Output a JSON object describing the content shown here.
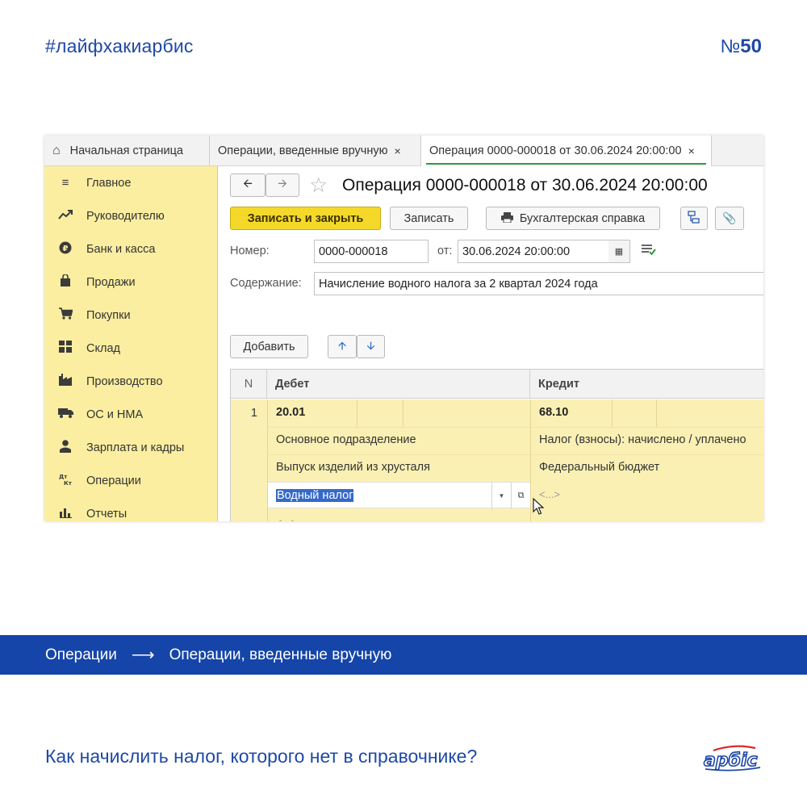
{
  "header": {
    "hashtag": "#лайфхакиарбис",
    "number_prefix": "№",
    "number": "50"
  },
  "tabs": [
    {
      "label": "Начальная страница",
      "icon": "home-icon"
    },
    {
      "label": "Операции, введенные вручную",
      "close": "×"
    },
    {
      "label": "Операция 0000-000018 от 30.06.2024 20:00:00",
      "close": "×",
      "active": true
    }
  ],
  "sidebar": {
    "items": [
      {
        "label": "Главное",
        "icon": "menu-icon"
      },
      {
        "label": "Руководителю",
        "icon": "trend-icon"
      },
      {
        "label": "Банк и касса",
        "icon": "ruble-icon"
      },
      {
        "label": "Продажи",
        "icon": "bag-icon"
      },
      {
        "label": "Покупки",
        "icon": "cart-icon"
      },
      {
        "label": "Склад",
        "icon": "warehouse-icon"
      },
      {
        "label": "Производство",
        "icon": "factory-icon"
      },
      {
        "label": "ОС и НМА",
        "icon": "truck-icon"
      },
      {
        "label": "Зарплата и кадры",
        "icon": "person-icon"
      },
      {
        "label": "Операции",
        "icon": "dt-kt-icon"
      },
      {
        "label": "Отчеты",
        "icon": "bar-chart-icon"
      }
    ],
    "dt_kt_glyph_top": "Дт",
    "dt_kt_glyph_bottom": "Кт"
  },
  "document": {
    "title": "Операция 0000-000018 от 30.06.2024 20:00:00",
    "buttons": {
      "save_close": "Записать и закрыть",
      "save": "Записать",
      "reference": "Бухгалтерская справка",
      "add": "Добавить"
    },
    "fields": {
      "number_label": "Номер:",
      "number_value": "0000-000018",
      "date_label": "от:",
      "date_value": "30.06.2024 20:00:00",
      "content_label": "Содержание:",
      "content_value": "Начисление водного налога за 2 квартал 2024 года"
    }
  },
  "grid": {
    "columns": {
      "n": "N",
      "debit": "Дебет",
      "credit": "Кредит"
    },
    "row": {
      "n": "1",
      "debit_account": "20.01",
      "credit_account": "68.10",
      "debit_subconto_1": "Основное подразделение",
      "credit_subconto_1": "Налог (взносы): начислено / уплачено",
      "debit_subconto_2": "Выпуск изделий из хрусталя",
      "credit_subconto_2": "Федеральный бюджет",
      "debit_subconto_3_editing": "Водный налог",
      "credit_subconto_3": "<...>",
      "debit_empty": "<...>"
    }
  },
  "breadcrumb": {
    "section": "Операции",
    "arrow": "⟶",
    "page": "Операции, введенные вручную"
  },
  "footer": {
    "question": "Как начислить налог, которого нет в справочнике?",
    "logo_text": "арбис"
  },
  "colors": {
    "brand_blue": "#1545a8",
    "sidebar_yellow": "#fbeea0",
    "grid_yellow": "#fbf0b4",
    "primary_button": "#f5d92a",
    "active_tab_underline": "#2f9a3f",
    "selection": "#3569c9"
  }
}
